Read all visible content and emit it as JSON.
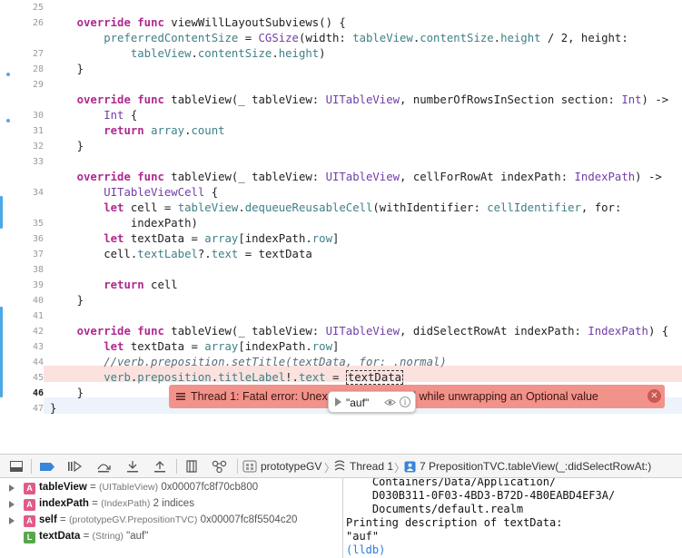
{
  "editor": {
    "lines": [
      {
        "num": "25",
        "tokens": [
          {
            "t": ""
          }
        ]
      },
      {
        "num": "26",
        "tokens": [
          {
            "t": "    "
          },
          {
            "t": "override",
            "c": "kw"
          },
          {
            "t": " "
          },
          {
            "t": "func",
            "c": "kw"
          },
          {
            "t": " viewWillLayoutSubviews() {"
          }
        ]
      },
      {
        "num": "",
        "tokens": [
          {
            "t": "        "
          },
          {
            "t": "preferredContentSize",
            "c": "pr"
          },
          {
            "t": " = "
          },
          {
            "t": "CGSize",
            "c": "ty"
          },
          {
            "t": "(width: "
          },
          {
            "t": "tableView",
            "c": "pr"
          },
          {
            "t": "."
          },
          {
            "t": "contentSize",
            "c": "pr"
          },
          {
            "t": "."
          },
          {
            "t": "height",
            "c": "pr"
          },
          {
            "t": " / 2, height:"
          }
        ]
      },
      {
        "num": "27",
        "tokens": [
          {
            "t": "            "
          },
          {
            "t": "tableView",
            "c": "pr"
          },
          {
            "t": "."
          },
          {
            "t": "contentSize",
            "c": "pr"
          },
          {
            "t": "."
          },
          {
            "t": "height",
            "c": "pr"
          },
          {
            "t": ")"
          }
        ]
      },
      {
        "num": "28",
        "tokens": [
          {
            "t": "    }"
          }
        ]
      },
      {
        "num": "29",
        "tokens": [
          {
            "t": ""
          }
        ]
      },
      {
        "num": "",
        "tokens": [
          {
            "t": "    "
          },
          {
            "t": "override",
            "c": "kw"
          },
          {
            "t": " "
          },
          {
            "t": "func",
            "c": "kw"
          },
          {
            "t": " tableView(_ tableView: "
          },
          {
            "t": "UITableView",
            "c": "ty"
          },
          {
            "t": ", numberOfRowsInSection section: "
          },
          {
            "t": "Int",
            "c": "ty"
          },
          {
            "t": ") ->"
          }
        ]
      },
      {
        "num": "30",
        "tokens": [
          {
            "t": "        "
          },
          {
            "t": "Int",
            "c": "ty"
          },
          {
            "t": " {"
          }
        ]
      },
      {
        "num": "31",
        "tokens": [
          {
            "t": "        "
          },
          {
            "t": "return",
            "c": "kw"
          },
          {
            "t": " "
          },
          {
            "t": "array",
            "c": "pr"
          },
          {
            "t": "."
          },
          {
            "t": "count",
            "c": "pr"
          }
        ]
      },
      {
        "num": "32",
        "tokens": [
          {
            "t": "    }"
          }
        ]
      },
      {
        "num": "33",
        "tokens": [
          {
            "t": ""
          }
        ]
      },
      {
        "num": "",
        "tokens": [
          {
            "t": "    "
          },
          {
            "t": "override",
            "c": "kw"
          },
          {
            "t": " "
          },
          {
            "t": "func",
            "c": "kw"
          },
          {
            "t": " tableView(_ tableView: "
          },
          {
            "t": "UITableView",
            "c": "ty"
          },
          {
            "t": ", cellForRowAt indexPath: "
          },
          {
            "t": "IndexPath",
            "c": "ty"
          },
          {
            "t": ") ->"
          }
        ]
      },
      {
        "num": "34",
        "tokens": [
          {
            "t": "        "
          },
          {
            "t": "UITableViewCell",
            "c": "ty"
          },
          {
            "t": " {"
          }
        ]
      },
      {
        "num": "",
        "tokens": [
          {
            "t": "        "
          },
          {
            "t": "let",
            "c": "kw"
          },
          {
            "t": " cell = "
          },
          {
            "t": "tableView",
            "c": "pr"
          },
          {
            "t": "."
          },
          {
            "t": "dequeueReusableCell",
            "c": "pr"
          },
          {
            "t": "(withIdentifier: "
          },
          {
            "t": "cellIdentifier",
            "c": "pr"
          },
          {
            "t": ", for:"
          }
        ]
      },
      {
        "num": "35",
        "tokens": [
          {
            "t": "            indexPath)"
          }
        ]
      },
      {
        "num": "36",
        "tokens": [
          {
            "t": "        "
          },
          {
            "t": "let",
            "c": "kw"
          },
          {
            "t": " textData = "
          },
          {
            "t": "array",
            "c": "pr"
          },
          {
            "t": "[indexPath."
          },
          {
            "t": "row",
            "c": "pr"
          },
          {
            "t": "]"
          }
        ]
      },
      {
        "num": "37",
        "tokens": [
          {
            "t": "        cell."
          },
          {
            "t": "textLabel",
            "c": "pr"
          },
          {
            "t": "?."
          },
          {
            "t": "text",
            "c": "pr"
          },
          {
            "t": " = textData"
          }
        ]
      },
      {
        "num": "38",
        "tokens": [
          {
            "t": ""
          }
        ]
      },
      {
        "num": "39",
        "tokens": [
          {
            "t": "        "
          },
          {
            "t": "return",
            "c": "kw"
          },
          {
            "t": " cell"
          }
        ]
      },
      {
        "num": "40",
        "tokens": [
          {
            "t": "    }"
          }
        ]
      },
      {
        "num": "41",
        "tokens": [
          {
            "t": ""
          }
        ]
      },
      {
        "num": "42",
        "tokens": [
          {
            "t": "    "
          },
          {
            "t": "override",
            "c": "kw"
          },
          {
            "t": " "
          },
          {
            "t": "func",
            "c": "kw"
          },
          {
            "t": " tableView(_ tableView: "
          },
          {
            "t": "UITableView",
            "c": "ty"
          },
          {
            "t": ", didSelectRowAt indexPath: "
          },
          {
            "t": "IndexPath",
            "c": "ty"
          },
          {
            "t": ") {"
          }
        ]
      },
      {
        "num": "43",
        "tokens": [
          {
            "t": "        "
          },
          {
            "t": "let",
            "c": "kw"
          },
          {
            "t": " textData = "
          },
          {
            "t": "array",
            "c": "pr"
          },
          {
            "t": "[indexPath."
          },
          {
            "t": "row",
            "c": "pr"
          },
          {
            "t": "]"
          }
        ]
      },
      {
        "num": "44",
        "tokens": [
          {
            "t": "        //verb.preposition.setTitle(textData, for: .normal)",
            "c": "cm"
          }
        ]
      },
      {
        "num": "45",
        "tokens": [
          {
            "t": "        "
          },
          {
            "t": "verb",
            "c": "pr"
          },
          {
            "t": "."
          },
          {
            "t": "preposition",
            "c": "pr"
          },
          {
            "t": "."
          },
          {
            "t": "titleLabel",
            "c": "pr"
          },
          {
            "t": "!."
          },
          {
            "t": "text",
            "c": "pr"
          },
          {
            "t": " = "
          },
          {
            "t": "textData",
            "c": "box"
          }
        ]
      },
      {
        "num": "46",
        "tokens": [
          {
            "t": "    }"
          }
        ]
      },
      {
        "num": "47",
        "tokens": [
          {
            "t": "}"
          }
        ]
      },
      {
        "num": "",
        "tokens": [
          {
            "t": ""
          }
        ]
      }
    ],
    "error_banner": {
      "text": "Thread 1: Fatal error: Unexpectedly found nil while unwrapping an Optional value",
      "close_icon": "close-circle-icon",
      "color": "#f2938b"
    },
    "datatip": {
      "value": "\"auf\""
    }
  },
  "debug_bar": {
    "crumbs": [
      "prototypeGV",
      "Thread 1",
      "7 PrepositionTVC.tableView(_:didSelectRowAt:)"
    ]
  },
  "variables": [
    {
      "badge": "A",
      "badge_color": "#e05b8a",
      "name": "tableView",
      "type": "(UITableView)",
      "value": "0x00007fc8f70cb800",
      "expandable": true
    },
    {
      "badge": "A",
      "badge_color": "#e05b8a",
      "name": "indexPath",
      "type": "(IndexPath)",
      "value": "2 indices",
      "expandable": true
    },
    {
      "badge": "A",
      "badge_color": "#e05b8a",
      "name": "self",
      "type": "(prototypeGV.PrepositionTVC)",
      "value": "0x00007fc8f5504c20",
      "expandable": true
    },
    {
      "badge": "L",
      "badge_color": "#56a84a",
      "name": "textData",
      "type": "(String)",
      "value": "\"auf\"",
      "expandable": false
    }
  ],
  "console": {
    "lines": [
      "    Containers/Data/Application/",
      "    D030B311-0F03-4BD3-B72D-4B0EABD4EF3A/",
      "    Documents/default.realm",
      "Printing description of textData:",
      "\"auf\"",
      "(lldb)"
    ]
  }
}
